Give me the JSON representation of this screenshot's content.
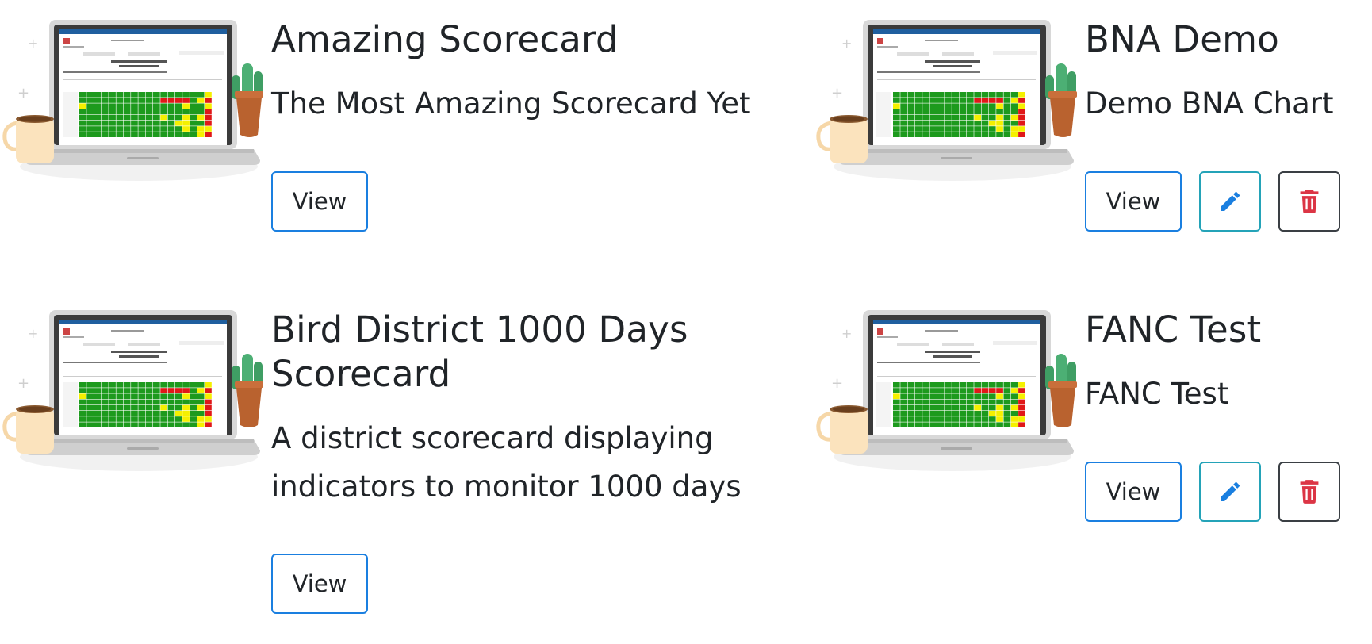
{
  "cards": [
    {
      "title": "Amazing Scorecard",
      "description": "The Most Amazing Scorecard Yet",
      "view_label": "View",
      "actions": [
        "view"
      ]
    },
    {
      "title": "BNA Demo",
      "description": "Demo BNA Chart",
      "view_label": "View",
      "actions": [
        "view",
        "edit",
        "delete"
      ],
      "edit_icon": "pencil-icon",
      "delete_icon": "trash-icon"
    },
    {
      "title": "Bird District 1000 Days Scorecard",
      "description": "A district scorecard displaying indicators to monitor 1000 days",
      "view_label": "View",
      "actions": [
        "view"
      ]
    },
    {
      "title": "FANC Test",
      "description": "FANC Test",
      "view_label": "View",
      "actions": [
        "view",
        "edit",
        "delete"
      ],
      "edit_icon": "pencil-icon",
      "delete_icon": "trash-icon"
    }
  ],
  "thumbnail": {
    "screen_title": "HMIS DATASET COMPLETENESS SCORECARD"
  },
  "colors": {
    "view_border": "#1a7fe0",
    "edit_border": "#24a3b8",
    "edit_icon": "#1a7fe0",
    "delete_border": "#3a3f44",
    "delete_icon": "#dc3545",
    "score_green": "#1d9a1d",
    "score_yellow": "#f5f000",
    "score_red": "#e01818"
  }
}
